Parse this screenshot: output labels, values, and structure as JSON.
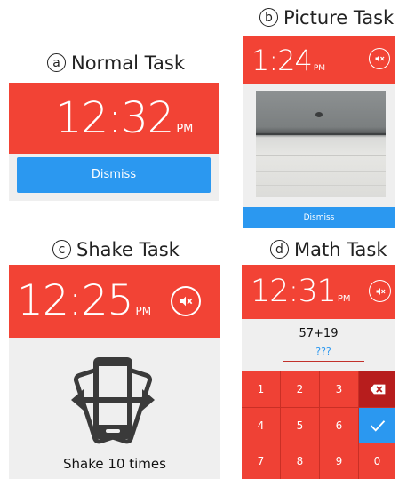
{
  "captions": {
    "a_letter": "a",
    "a_title": "Normal Task",
    "b_letter": "b",
    "b_title": "Picture Task",
    "c_letter": "c",
    "c_title": "Shake Task",
    "d_letter": "d",
    "d_title": "Math Task"
  },
  "normal": {
    "time": "12:32",
    "ampm": "PM",
    "dismiss": "Dismiss"
  },
  "picture": {
    "time": "1:24",
    "ampm": "PM",
    "dismiss": "Dismiss",
    "mute_icon": "mute-icon"
  },
  "shake": {
    "time": "12:25",
    "ampm": "PM",
    "instruction": "Shake 10 times",
    "mute_icon": "mute-icon",
    "phone_icon": "shake-phone-icon"
  },
  "math": {
    "time": "12:31",
    "ampm": "PM",
    "problem": "57+19",
    "answer_placeholder": "???",
    "keys": [
      "1",
      "2",
      "3",
      "4",
      "5",
      "6",
      "7",
      "8",
      "9",
      "0"
    ],
    "mute_icon": "mute-icon",
    "delete_icon": "backspace-icon",
    "ok_icon": "check-icon"
  },
  "colors": {
    "accent_red": "#f24335",
    "dismiss_blue": "#2b98f0",
    "delete_red": "#b71d1d",
    "background": "#efefef"
  }
}
